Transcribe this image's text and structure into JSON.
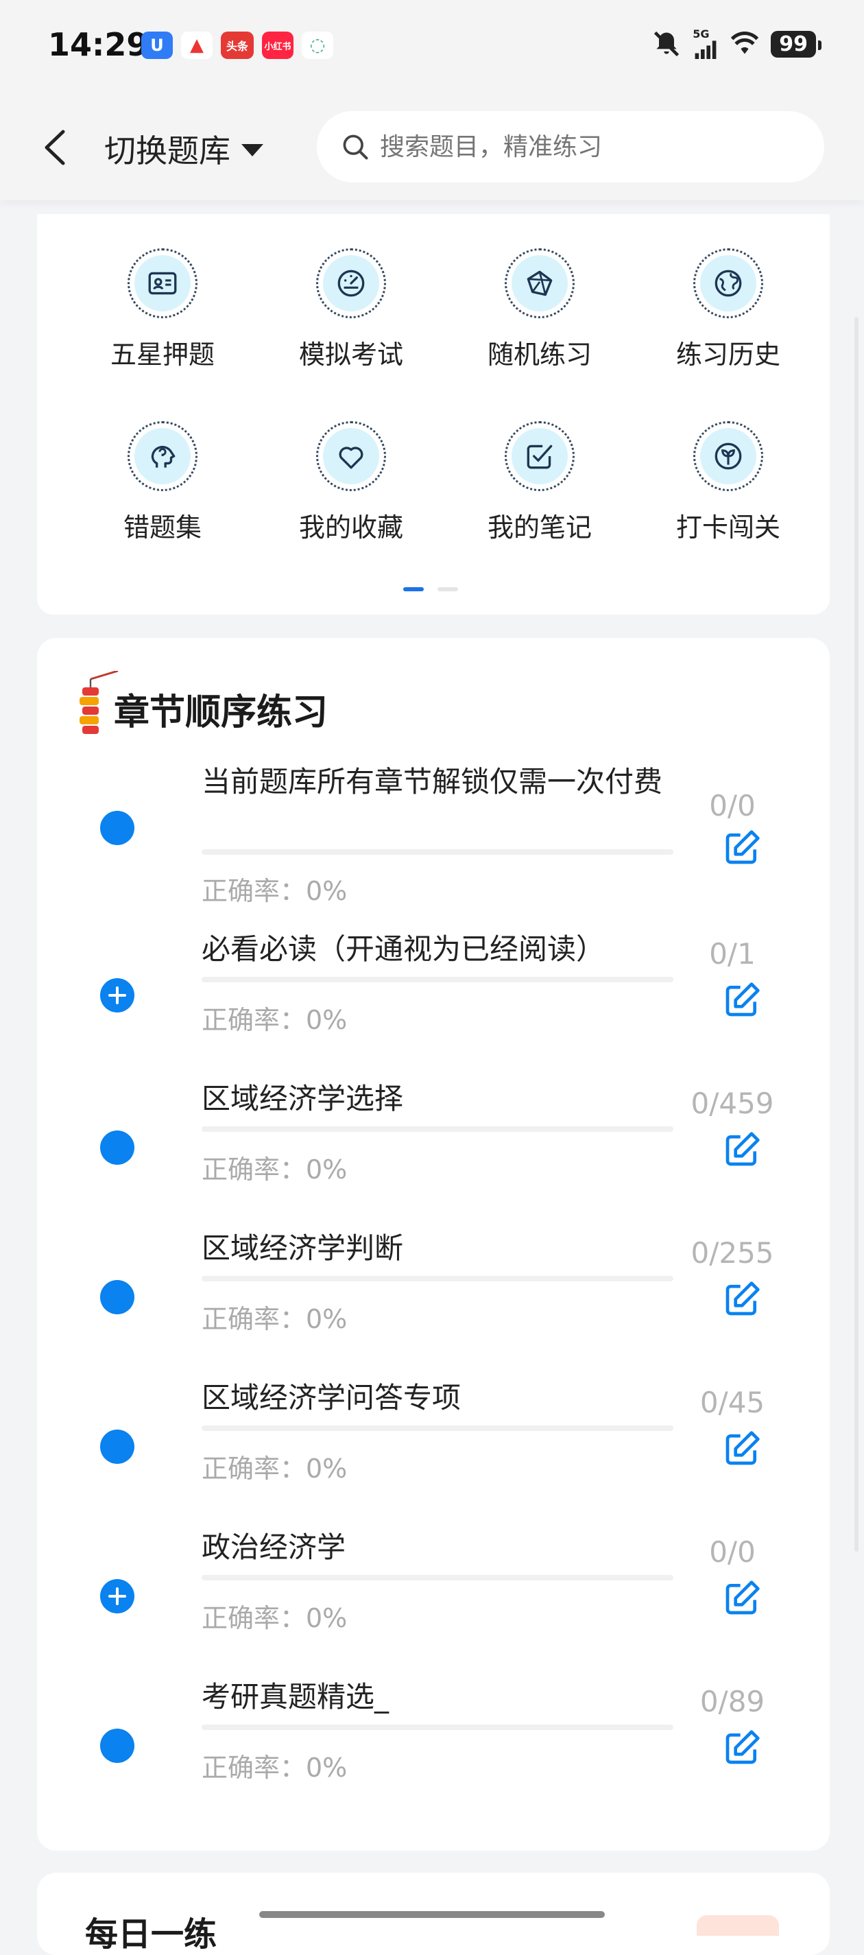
{
  "status_bar": {
    "time": "14:29",
    "notification_apps": [
      "U",
      "▲",
      "头条",
      "小红书",
      "◌"
    ],
    "network": "5G",
    "battery": "99"
  },
  "header": {
    "title": "切换题库",
    "search_placeholder": "搜索题目，精准练习"
  },
  "shortcuts": [
    {
      "label": "五星押题",
      "icon": "id-card-icon"
    },
    {
      "label": "模拟考试",
      "icon": "gauge-icon"
    },
    {
      "label": "随机练习",
      "icon": "network-icon"
    },
    {
      "label": "练习历史",
      "icon": "globe-icon"
    },
    {
      "label": "错题集",
      "icon": "head-icon"
    },
    {
      "label": "我的收藏",
      "icon": "heart-icon"
    },
    {
      "label": "我的笔记",
      "icon": "checkbox-icon"
    },
    {
      "label": "打卡闯关",
      "icon": "sprout-icon"
    }
  ],
  "chapter_section": {
    "title": "章节顺序练习",
    "rows": [
      {
        "title": "当前题库所有章节解锁仅需一次付费",
        "accuracy": "正确率：0%",
        "count": "0/0",
        "expandable": false
      },
      {
        "title": "必看必读（开通视为已经阅读）",
        "accuracy": "正确率：0%",
        "count": "0/1",
        "expandable": true
      },
      {
        "title": "区域经济学选择",
        "accuracy": "正确率：0%",
        "count": "0/459",
        "expandable": false
      },
      {
        "title": "区域经济学判断",
        "accuracy": "正确率：0%",
        "count": "0/255",
        "expandable": false
      },
      {
        "title": "区域经济学问答专项",
        "accuracy": "正确率：0%",
        "count": "0/45",
        "expandable": false
      },
      {
        "title": "政治经济学",
        "accuracy": "正确率：0%",
        "count": "0/0",
        "expandable": true
      },
      {
        "title": "考研真题精选_",
        "accuracy": "正确率：0%",
        "count": "0/89",
        "expandable": false
      }
    ]
  },
  "bottom_card": {
    "title": "每日一练"
  },
  "colors": {
    "accent": "#0a82ef",
    "icon_bg": "#d8f3fb",
    "muted_text": "#aaaaaa"
  }
}
